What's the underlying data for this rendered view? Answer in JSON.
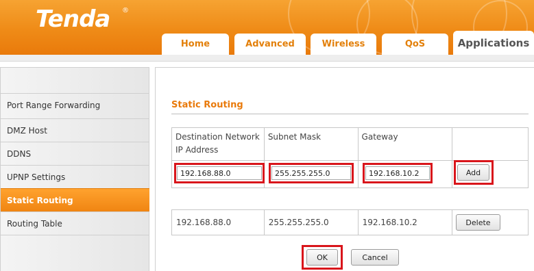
{
  "brand": {
    "logo": "Tenda",
    "registered": "®"
  },
  "tabs": [
    {
      "label": "Home"
    },
    {
      "label": "Advanced"
    },
    {
      "label": "Wireless"
    },
    {
      "label": "QoS"
    },
    {
      "label": "Applications"
    }
  ],
  "active_tab": "Applications",
  "sidebar": {
    "items": [
      {
        "label": "Port Range Forwarding"
      },
      {
        "label": "DMZ Host"
      },
      {
        "label": "DDNS"
      },
      {
        "label": "UPNP Settings"
      },
      {
        "label": "Static Routing"
      },
      {
        "label": "Routing Table"
      }
    ],
    "active": "Static Routing"
  },
  "static_routing": {
    "title": "Static Routing",
    "columns": [
      "Destination Network IP Address",
      "Subnet Mask",
      "Gateway"
    ],
    "inputs": {
      "destination": "192.168.88.0",
      "subnet_mask": "255.255.255.0",
      "gateway": "192.168.10.2"
    },
    "add_label": "Add",
    "routes": [
      {
        "destination": "192.168.88.0",
        "subnet_mask": "255.255.255.0",
        "gateway": "192.168.10.2",
        "delete_label": "Delete"
      }
    ],
    "ok_label": "OK",
    "cancel_label": "Cancel"
  },
  "colors": {
    "brand_orange": "#ef8b17",
    "highlight_red": "#d9151b"
  }
}
